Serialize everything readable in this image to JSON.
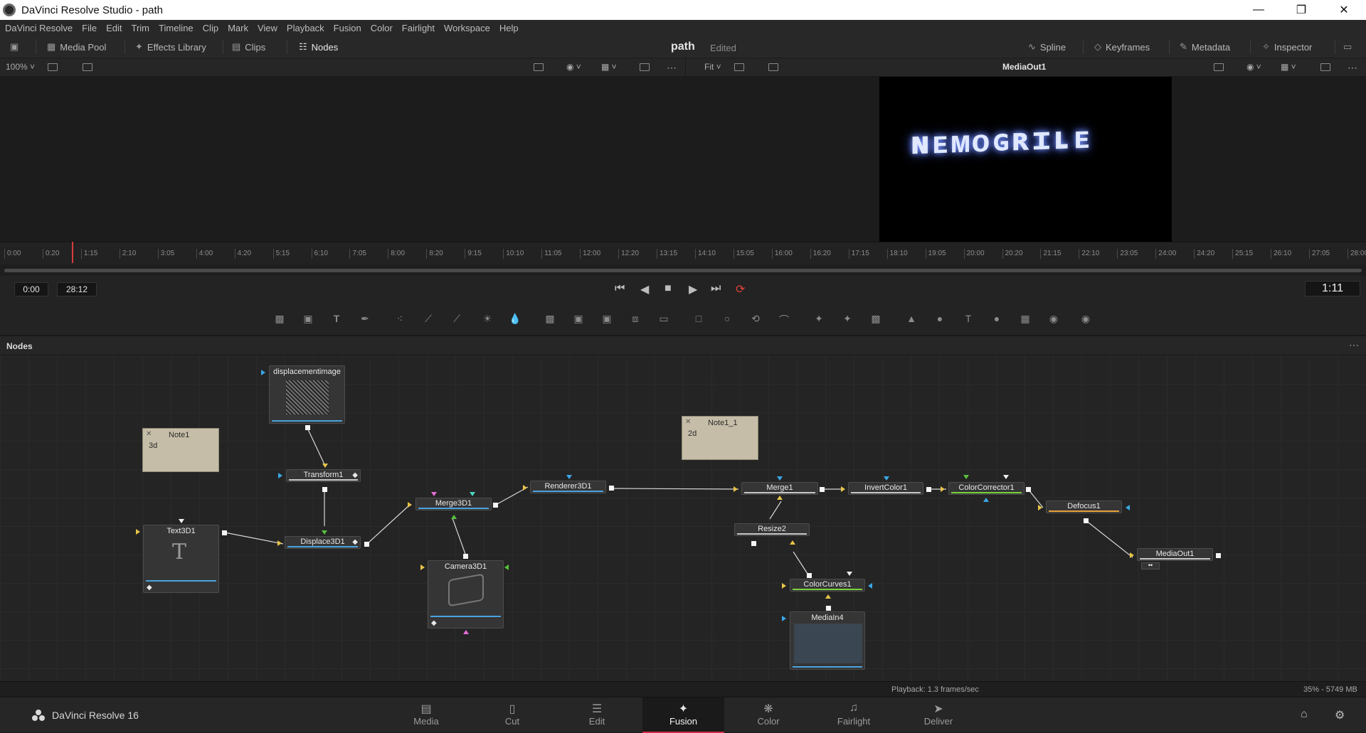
{
  "window": {
    "title": "DaVinci Resolve Studio - path"
  },
  "menu": [
    "DaVinci Resolve",
    "File",
    "Edit",
    "Trim",
    "Timeline",
    "Clip",
    "Mark",
    "View",
    "Playback",
    "Fusion",
    "Color",
    "Fairlight",
    "Workspace",
    "Help"
  ],
  "toolbar": {
    "media_pool": "Media Pool",
    "effects_library": "Effects Library",
    "clips": "Clips",
    "nodes": "Nodes",
    "project_name": "path",
    "project_status": "Edited",
    "spline": "Spline",
    "keyframes": "Keyframes",
    "metadata": "Metadata",
    "inspector": "Inspector"
  },
  "viewer": {
    "left_zoom": "100%",
    "right_zoom": "Fit",
    "right_title": "MediaOut1",
    "preview_text": "ɴᴇᴍᴏɢʀɪʟᴇ"
  },
  "ruler_ticks": [
    "0:00",
    "0:20",
    "1:15",
    "2:10",
    "3:05",
    "4:00",
    "4:20",
    "5:15",
    "6:10",
    "7:05",
    "8:00",
    "8:20",
    "9:15",
    "10:10",
    "11:05",
    "12:00",
    "12:20",
    "13:15",
    "14:10",
    "15:05",
    "16:00",
    "16:20",
    "17:15",
    "18:10",
    "19:05",
    "20:00",
    "20:20",
    "21:15",
    "22:10",
    "23:05",
    "24:00",
    "24:20",
    "25:15",
    "26:10",
    "27:05",
    "28:00"
  ],
  "transport": {
    "in": "0:00",
    "out": "28:12",
    "current": "1:11"
  },
  "nodes_panel": {
    "title": "Nodes",
    "notes": [
      {
        "title": "Note1",
        "body": "3d"
      },
      {
        "title": "Note1_1",
        "body": "2d"
      }
    ],
    "nodes": {
      "displacementimage": "displacementimage",
      "transform": "Transform1",
      "text3d": "Text3D1",
      "displace3d": "Displace3D1",
      "merge3d": "Merge3D1",
      "camera3d": "Camera3D1",
      "renderer3d": "Renderer3D1",
      "merge": "Merge1",
      "resize": "Resize2",
      "invert": "InvertColor1",
      "colorcorrector": "ColorCorrector1",
      "defocus": "Defocus1",
      "mediaout": "MediaOut1",
      "colorcurves": "ColorCurves1",
      "mediain": "MediaIn4"
    }
  },
  "status": {
    "playback": "Playback: 1.3 frames/sec",
    "memory": "35% - 5749 MB"
  },
  "pages": {
    "brand": "DaVinci Resolve 16",
    "items": [
      {
        "label": "Media",
        "icon": "media-icon"
      },
      {
        "label": "Cut",
        "icon": "cut-icon"
      },
      {
        "label": "Edit",
        "icon": "edit-icon"
      },
      {
        "label": "Fusion",
        "icon": "fusion-icon"
      },
      {
        "label": "Color",
        "icon": "color-icon"
      },
      {
        "label": "Fairlight",
        "icon": "fairlight-icon"
      },
      {
        "label": "Deliver",
        "icon": "deliver-icon"
      }
    ],
    "active": "Fusion"
  },
  "colors": {
    "accent": "#d22c4a",
    "playhead": "#d83b3b",
    "note": "#c5bda7"
  }
}
